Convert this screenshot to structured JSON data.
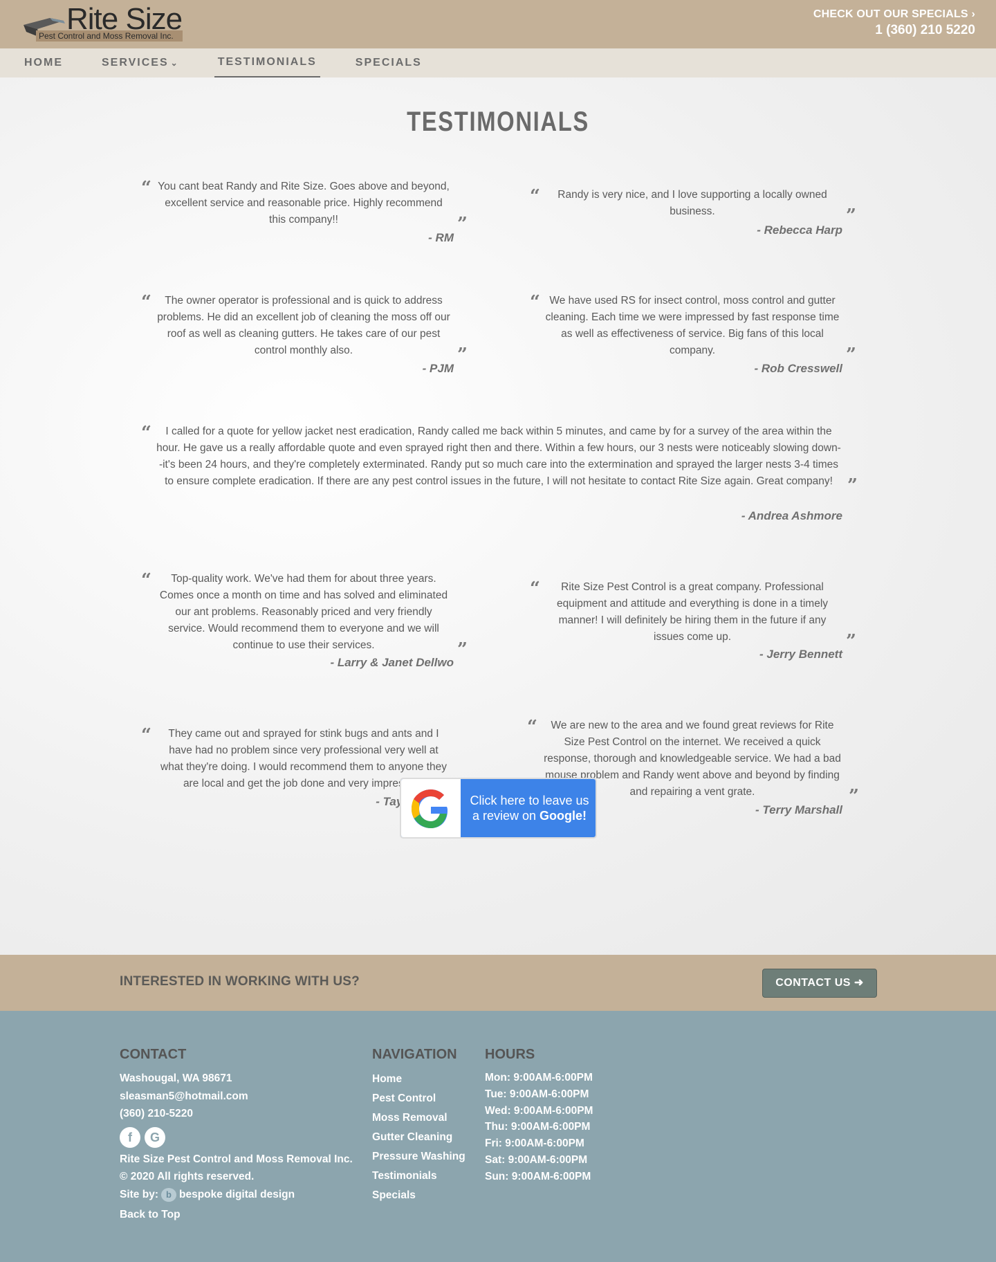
{
  "header": {
    "logo_title": "Rite Size",
    "logo_subtitle": "Pest Control and Moss Removal Inc.",
    "specials_link": "CHECK OUT OUR SPECIALS",
    "phone": "1 (360) 210 5220"
  },
  "nav": {
    "items": [
      "HOME",
      "SERVICES",
      "TESTIMONIALS",
      "SPECIALS"
    ],
    "active": "TESTIMONIALS"
  },
  "page": {
    "title": "TESTIMONIALS"
  },
  "testimonials": [
    {
      "text": "You cant beat Randy and Rite Size. Goes above and beyond, excellent service and reasonable price. Highly recommend this company!!",
      "author": "- RM"
    },
    {
      "text": "Randy is very nice, and I love supporting a locally owned business.",
      "author": "- Rebecca Harp"
    },
    {
      "text": "The owner operator is professional and is quick to address problems.  He did an excellent job of cleaning the moss off our roof as well as cleaning gutters.  He takes care of our pest control monthly also.",
      "author": "- PJM"
    },
    {
      "text": "We have used RS for insect control, moss control and gutter cleaning. Each time we were impressed by fast response time as well as effectiveness of service. Big fans of this local company.",
      "author": "- Rob Cresswell"
    },
    {
      "text": "I called for a quote for yellow jacket nest eradication,  Randy called me back within 5 minutes, and came by for a survey of the area within the hour. He gave us a really affordable quote and even sprayed right then and there. Within a few hours, our 3 nests were noticeably slowing down--it's been 24 hours, and they're completely exterminated. Randy put so much care into the extermination and sprayed the larger nests 3-4 times to ensure complete eradication. If there are any pest control issues in the future, I will not hesitate to contact Rite Size again. Great company!",
      "author": "- Andrea Ashmore"
    },
    {
      "text": "Top-quality work. We've had them for about three years. Comes once a month on time and has solved and eliminated our ant problems. Reasonably priced and very friendly service. Would recommend them to everyone and we will continue to use their services.",
      "author": "- Larry & Janet Dellwo"
    },
    {
      "text": "Rite Size Pest Control is a great company. Professional equipment and attitude and everything is done in a timely manner!  I will definitely be hiring them in the future if any issues come up.",
      "author": "- Jerry Bennett"
    },
    {
      "text": "They came out and sprayed for stink bugs and ants and I have had no problem since very professional very well at what they're doing.  I would recommend them to anyone they are local and get the job done and very impressed!",
      "author": "- Taylor Baker"
    },
    {
      "text": "We are new to the area and we found great reviews for Rite Size Pest Control on the internet.   We received a quick response, thorough and knowledgeable service.  We had a bad mouse problem and Randy went above and beyond by finding and repairing a vent grate.",
      "author": "- Terry Marshall"
    }
  ],
  "google_review": {
    "line1": "Click here to leave us",
    "line2_prefix": "a review on ",
    "line2_brand": "Google!"
  },
  "cta": {
    "text": "INTERESTED IN WORKING WITH US?",
    "button": "CONTACT US ➜"
  },
  "footer": {
    "contact": {
      "heading": "CONTACT",
      "address": "Washougal, WA 98671",
      "email": "sleasman5@hotmail.com",
      "phone": "(360) 210-5220",
      "social": [
        "f",
        "G"
      ],
      "company": "Rite Size Pest Control and Moss Removal Inc.",
      "copyright": "© 2020 All rights reserved.",
      "site_by_label": "Site by:",
      "site_by_icon": "b",
      "site_by_name": "bespoke digital design",
      "back_to_top": "Back to Top"
    },
    "navigation": {
      "heading": "NAVIGATION",
      "links": [
        "Home",
        "Pest Control",
        "Moss Removal",
        "Gutter Cleaning",
        "Pressure Washing",
        "Testimonials",
        "Specials"
      ]
    },
    "hours": {
      "heading": "HOURS",
      "lines": [
        "Mon: 9:00AM-6:00PM",
        "Tue: 9:00AM-6:00PM",
        "Wed: 9:00AM-6:00PM",
        "Thu: 9:00AM-6:00PM",
        "Fri: 9:00AM-6:00PM",
        "Sat: 9:00AM-6:00PM",
        "Sun: 9:00AM-6:00PM"
      ]
    }
  },
  "colors": {
    "header_bg": "#c4b198",
    "nav_bg": "#e6e1d8",
    "footer_bg": "#8ca5ae",
    "button_bg": "#6e7e78",
    "google_blue": "#3d83e8"
  }
}
